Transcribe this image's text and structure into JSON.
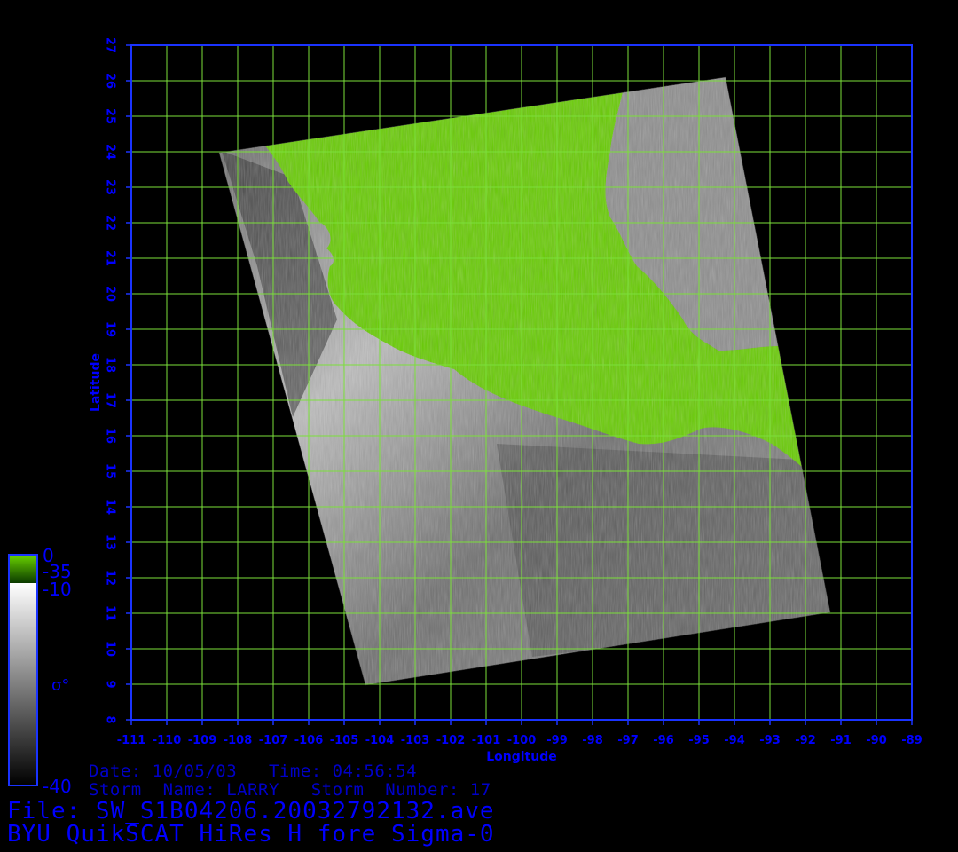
{
  "map": {
    "lon_range": [
      -111,
      -89
    ],
    "lat_range": [
      8,
      27
    ],
    "lon_ticks": [
      "-111",
      "-110",
      "-109",
      "-108",
      "-107",
      "-106",
      "-105",
      "-104",
      "-103",
      "-102",
      "-101",
      "-100",
      "-99",
      "-98",
      "-97",
      "-96",
      "-95",
      "-94",
      "-93",
      "-92",
      "-91",
      "-90",
      "-89"
    ],
    "lat_ticks": [
      "8",
      "9",
      "10",
      "11",
      "12",
      "13",
      "14",
      "15",
      "16",
      "17",
      "18",
      "19",
      "20",
      "21",
      "22",
      "23",
      "24",
      "25",
      "26",
      "27"
    ],
    "xlabel": "Longitude",
    "ylabel": "Latitude",
    "grid": true,
    "swath_corners_lonlat": [
      [
        -107.9,
        24.0
      ],
      [
        -94.2,
        26.1
      ],
      [
        -90.8,
        11.0
      ],
      [
        -104.1,
        9.0
      ]
    ],
    "colors": {
      "background": "#000000",
      "frame": "#1a33ff",
      "grid": "#7be03a",
      "land": "#66cc00",
      "ocean_light": "#c8c8c8",
      "ocean_dark": "#3a3a3a",
      "text": "#0000ff"
    }
  },
  "colorbar": {
    "land_max": "0",
    "land_min": "-35",
    "ocean_max": "-10",
    "ocean_min": "-40",
    "symbol": "σ°"
  },
  "info": {
    "date_line": "Date: 10/05/03   Time: 04:56:54",
    "storm_line": "Storm  Name: LARRY   Storm  Number: 17",
    "file_line": "File: SW_S1B04206.20032792132.ave",
    "product_line": "BYU QuikSCAT HiRes H fore Sigma-0"
  }
}
